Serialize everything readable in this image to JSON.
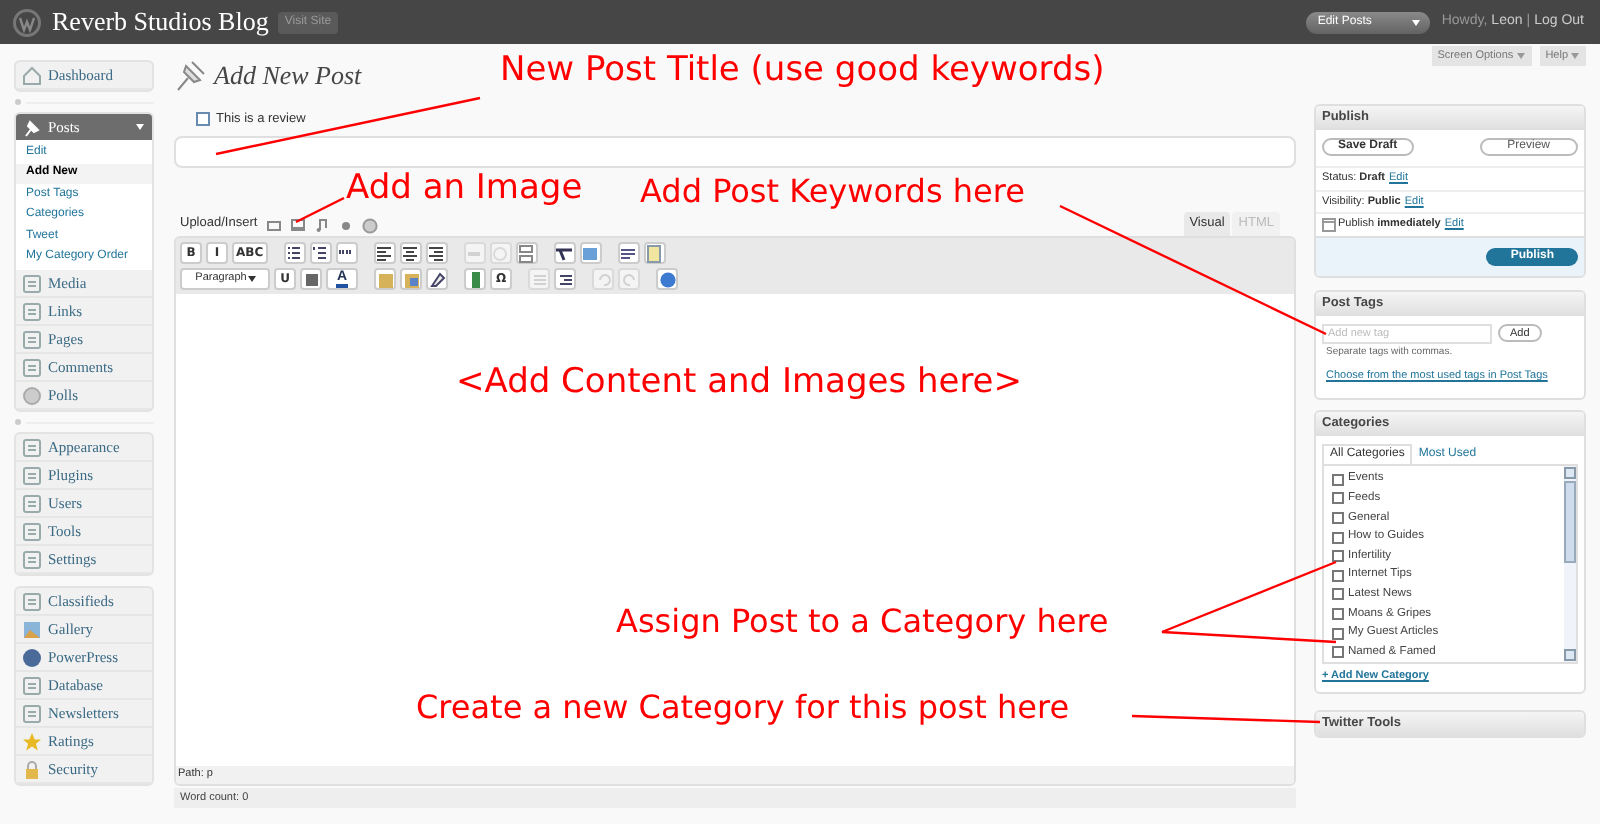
{
  "header": {
    "site_title": "Reverb Studios Blog",
    "visit_site": "Visit Site",
    "favorite_actions": "Edit Posts",
    "greeting": "Howdy,",
    "user": "Leon",
    "separator": "|",
    "logout": "Log Out"
  },
  "sidebar": {
    "groups": [
      [
        {
          "label": "Dashboard",
          "expanded": false
        }
      ],
      [
        {
          "label": "Posts",
          "expanded": true,
          "children": [
            {
              "label": "Edit",
              "selected": false
            },
            {
              "label": "Add New",
              "selected": true
            },
            {
              "label": "Post Tags",
              "selected": false
            },
            {
              "label": "Categories",
              "selected": false
            },
            {
              "label": "Tweet",
              "selected": false
            },
            {
              "label": "My Category Order",
              "selected": false
            }
          ]
        },
        {
          "label": "Media",
          "expanded": false
        },
        {
          "label": "Links",
          "expanded": false
        },
        {
          "label": "Pages",
          "expanded": false
        },
        {
          "label": "Comments",
          "expanded": false
        },
        {
          "label": "Polls",
          "expanded": false
        }
      ],
      [
        {
          "label": "Appearance",
          "expanded": false
        },
        {
          "label": "Plugins",
          "expanded": false
        },
        {
          "label": "Users",
          "expanded": false
        },
        {
          "label": "Tools",
          "expanded": false
        },
        {
          "label": "Settings",
          "expanded": false
        }
      ],
      [
        {
          "label": "Classifieds",
          "expanded": false
        },
        {
          "label": "Gallery",
          "expanded": false
        },
        {
          "label": "PowerPress",
          "expanded": false
        },
        {
          "label": "Database",
          "expanded": false
        },
        {
          "label": "Newsletters",
          "expanded": false
        },
        {
          "label": "Ratings",
          "expanded": false
        },
        {
          "label": "Security",
          "expanded": false
        }
      ]
    ]
  },
  "screen_buttons": [
    "Screen Options",
    "Help"
  ],
  "main": {
    "title": "Add New Post",
    "review_checkbox": {
      "label": "This is a review",
      "checked": false
    },
    "upload_label": "Upload/Insert",
    "editor_tabs": [
      {
        "label": "Visual",
        "selected": true
      },
      {
        "label": "HTML",
        "selected": false
      }
    ],
    "toolbar_rows": [
      [
        {
          "kind": "text",
          "label": "B",
          "disabled": false
        },
        {
          "kind": "text",
          "label": "I",
          "disabled": false
        },
        {
          "kind": "text",
          "label": "ABC",
          "disabled": false
        },
        {
          "kind": "bulleted-list",
          "disabled": false
        },
        {
          "kind": "numbered-list",
          "disabled": false
        },
        {
          "kind": "quote",
          "disabled": false
        },
        {
          "kind": "align-left",
          "disabled": false
        },
        {
          "kind": "align-center",
          "disabled": false
        },
        {
          "kind": "align-right",
          "disabled": false
        },
        {
          "kind": "link",
          "disabled": true
        },
        {
          "kind": "unlink",
          "disabled": true
        },
        {
          "kind": "more",
          "disabled": false
        },
        {
          "kind": "spellcheck",
          "disabled": false
        },
        {
          "kind": "fullscreen",
          "disabled": false
        },
        {
          "kind": "kitchen-sink",
          "disabled": false
        },
        {
          "kind": "plugin",
          "disabled": false
        }
      ],
      [
        {
          "kind": "select",
          "label": "Paragraph",
          "disabled": false
        },
        {
          "kind": "text",
          "label": "U",
          "disabled": false
        },
        {
          "kind": "justify",
          "disabled": false
        },
        {
          "kind": "text-color",
          "label": "A",
          "disabled": false
        },
        {
          "kind": "paste-text",
          "disabled": false
        },
        {
          "kind": "paste-word",
          "disabled": false
        },
        {
          "kind": "eraser",
          "disabled": false
        },
        {
          "kind": "media",
          "disabled": false
        },
        {
          "kind": "text",
          "label": "Ω",
          "disabled": false
        },
        {
          "kind": "outdent",
          "disabled": true
        },
        {
          "kind": "indent",
          "disabled": false
        },
        {
          "kind": "undo",
          "disabled": true
        },
        {
          "kind": "redo",
          "disabled": true
        },
        {
          "kind": "help",
          "disabled": false
        }
      ]
    ],
    "path": "Path: p",
    "word_count": "Word count: 0"
  },
  "publish": {
    "title": "Publish",
    "save_draft": "Save Draft",
    "preview": "Preview",
    "rows": [
      {
        "kind": "status",
        "label": "Status:",
        "value": "Draft",
        "link": "Edit"
      },
      {
        "kind": "visibility",
        "label": "Visibility:",
        "value": "Public",
        "link": "Edit"
      },
      {
        "kind": "schedule",
        "label": "Publish",
        "value": "immediately",
        "link": "Edit"
      }
    ],
    "publish_button": "Publish"
  },
  "post_tags": {
    "title": "Post Tags",
    "placeholder": "Add new tag",
    "add_button": "Add",
    "hint": "Separate tags with commas.",
    "link": "Choose from the most used tags in Post Tags"
  },
  "categories": {
    "title": "Categories",
    "tabs": [
      {
        "label": "All Categories",
        "selected": true
      },
      {
        "label": "Most Used",
        "selected": false
      }
    ],
    "items": [
      {
        "label": "Events",
        "checked": false
      },
      {
        "label": "Feeds",
        "checked": false
      },
      {
        "label": "General",
        "checked": false
      },
      {
        "label": "How to Guides",
        "checked": false
      },
      {
        "label": "Infertility",
        "checked": false
      },
      {
        "label": "Internet Tips",
        "checked": false
      },
      {
        "label": "Latest News",
        "checked": false
      },
      {
        "label": "Moans & Gripes",
        "checked": false
      },
      {
        "label": "My Guest Articles",
        "checked": false
      },
      {
        "label": "Named & Famed",
        "checked": false
      }
    ],
    "add_link": "+ Add New Category"
  },
  "twitter_tools": {
    "title": "Twitter Tools"
  },
  "annotations": [
    {
      "text": "New Post Title (use good keywords)"
    },
    {
      "text": "Add an Image"
    },
    {
      "text": "Add Post Keywords here"
    },
    {
      "text": "<Add Content and Images here>"
    },
    {
      "text": "Assign Post to a Category here"
    },
    {
      "text": "Create a new Category for this post here"
    }
  ]
}
